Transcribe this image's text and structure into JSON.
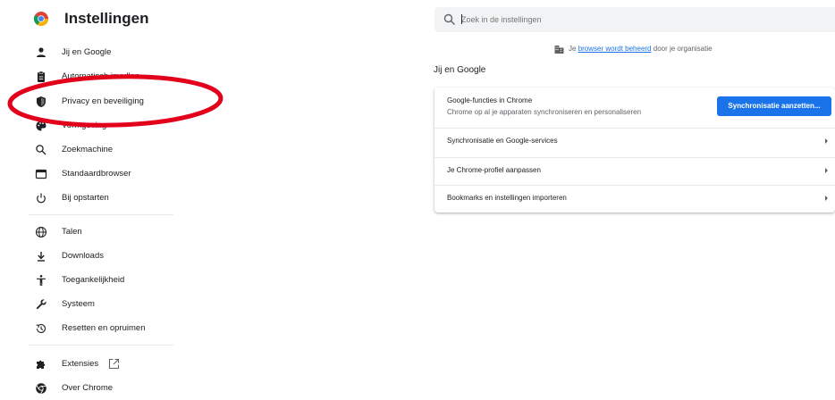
{
  "header": {
    "title": "Instellingen"
  },
  "search": {
    "placeholder": "Zoek in de instellingen"
  },
  "sidebar": {
    "items": [
      {
        "label": "Jij en Google",
        "icon": "person-icon"
      },
      {
        "label": "Automatisch invullen",
        "icon": "clipboard-icon"
      },
      {
        "label": "Privacy en beveiliging",
        "icon": "shield-icon"
      },
      {
        "label": "Vormgeving",
        "icon": "palette-icon"
      },
      {
        "label": "Zoekmachine",
        "icon": "search-icon"
      },
      {
        "label": "Standaardbrowser",
        "icon": "browser-icon"
      },
      {
        "label": "Bij opstarten",
        "icon": "power-icon"
      },
      {
        "label": "Talen",
        "icon": "globe-icon"
      },
      {
        "label": "Downloads",
        "icon": "download-icon"
      },
      {
        "label": "Toegankelijkheid",
        "icon": "accessibility-icon"
      },
      {
        "label": "Systeem",
        "icon": "wrench-icon"
      },
      {
        "label": "Resetten en opruimen",
        "icon": "restore-icon"
      },
      {
        "label": "Extensies",
        "icon": "puzzle-icon"
      },
      {
        "label": "Over Chrome",
        "icon": "chrome-icon"
      }
    ]
  },
  "managed": {
    "prefix": "Je",
    "link": "browser wordt beheerd",
    "suffix": "door je organisatie"
  },
  "section": {
    "title": "Jij en Google"
  },
  "card": {
    "sync_title": "Google-functies in Chrome",
    "sync_subtitle": "Chrome op al je apparaten synchroniseren en personaliseren",
    "sync_button": "Synchronisatie aanzetten...",
    "rows": [
      "Synchronisatie en Google-services",
      "Je Chrome-profiel aanpassen",
      "Bookmarks en instellingen importeren"
    ]
  },
  "colors": {
    "accent": "#1a73e8",
    "annotation": "#e3001b",
    "icon": "#5f6368"
  }
}
